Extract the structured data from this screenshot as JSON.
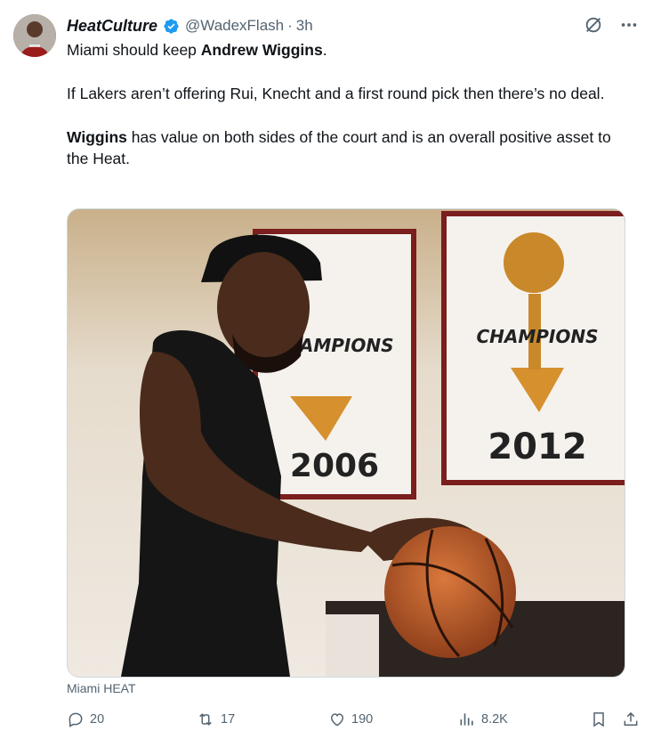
{
  "tweet": {
    "display_name": "HeatCulture",
    "handle": "@WadexFlash",
    "separator": "·",
    "time": "3h",
    "text": {
      "line1_prefix": "Miami should keep ",
      "line1_bold": "Andrew Wiggins",
      "line1_suffix": ".",
      "paragraph2": "If Lakers aren’t offering Rui, Knecht and a first round pick then there’s no deal.",
      "paragraph3_bold": "Wiggins",
      "paragraph3_rest": " has value on both sides of the court and is an overall positive asset to the Heat."
    },
    "media": {
      "banner_left_text": "CHAMPIONS",
      "banner_left_year": "2006",
      "banner_right_text": "CHAMPIONS",
      "banner_right_year": "2012"
    },
    "media_caption": "Miami HEAT",
    "stats": {
      "replies": "20",
      "reposts": "17",
      "likes": "190",
      "views": "8.2K"
    }
  },
  "colors": {
    "text": "#0f1419",
    "secondary": "#536471",
    "verified": "#1d9bf0"
  },
  "icons": [
    "verified-icon",
    "grok-icon",
    "more-icon",
    "reply-icon",
    "repost-icon",
    "like-icon",
    "views-icon",
    "bookmark-icon",
    "share-icon"
  ]
}
